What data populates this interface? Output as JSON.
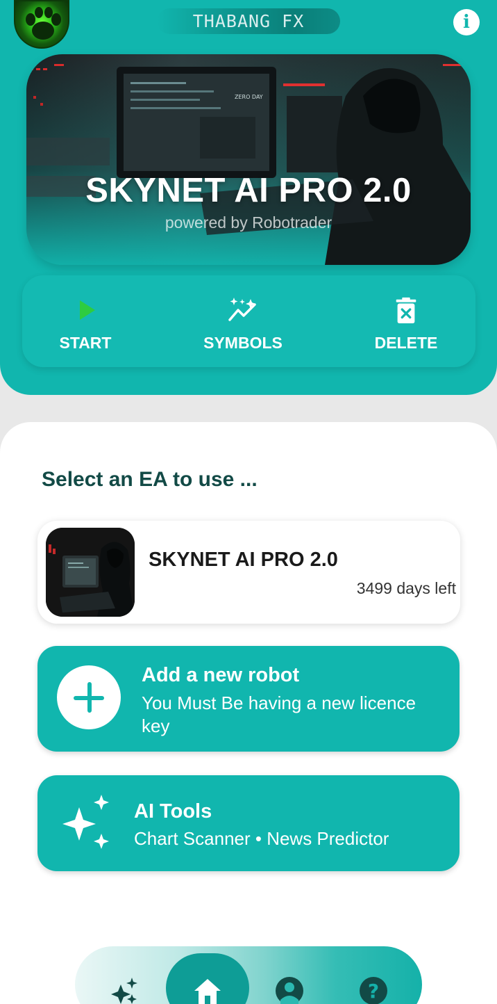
{
  "header": {
    "username": "THABANG  FX",
    "info_icon": "info-icon",
    "avatar_icon": "green-paw-avatar"
  },
  "hero": {
    "title": "SKYNET AI PRO 2.0",
    "subtitle": "powered by Robotrader"
  },
  "actions": [
    {
      "label": "START",
      "icon": "play-icon"
    },
    {
      "label": "SYMBOLS",
      "icon": "sparkle-chart-icon"
    },
    {
      "label": "DELETE",
      "icon": "trash-icon"
    }
  ],
  "content": {
    "section_title": "Select an EA to use ...",
    "ea": {
      "name": "SKYNET AI PRO 2.0",
      "days_left": "3499 days left"
    },
    "add_robot": {
      "title": "Add a new robot",
      "subtitle": "You Must Be having a new licence key"
    },
    "ai_tools": {
      "title": "AI Tools",
      "subtitle": "Chart Scanner • News Predictor"
    }
  },
  "bottom_nav": [
    {
      "name": "ai",
      "icon": "sparkles-icon"
    },
    {
      "name": "home",
      "icon": "home-icon",
      "active": true
    },
    {
      "name": "profile",
      "icon": "user-icon"
    },
    {
      "name": "help",
      "icon": "help-icon"
    }
  ],
  "colors": {
    "accent": "#11b6ae",
    "accent_dark": "#0e9d96",
    "start_green": "#2ecc40",
    "title_dark": "#124a46"
  }
}
